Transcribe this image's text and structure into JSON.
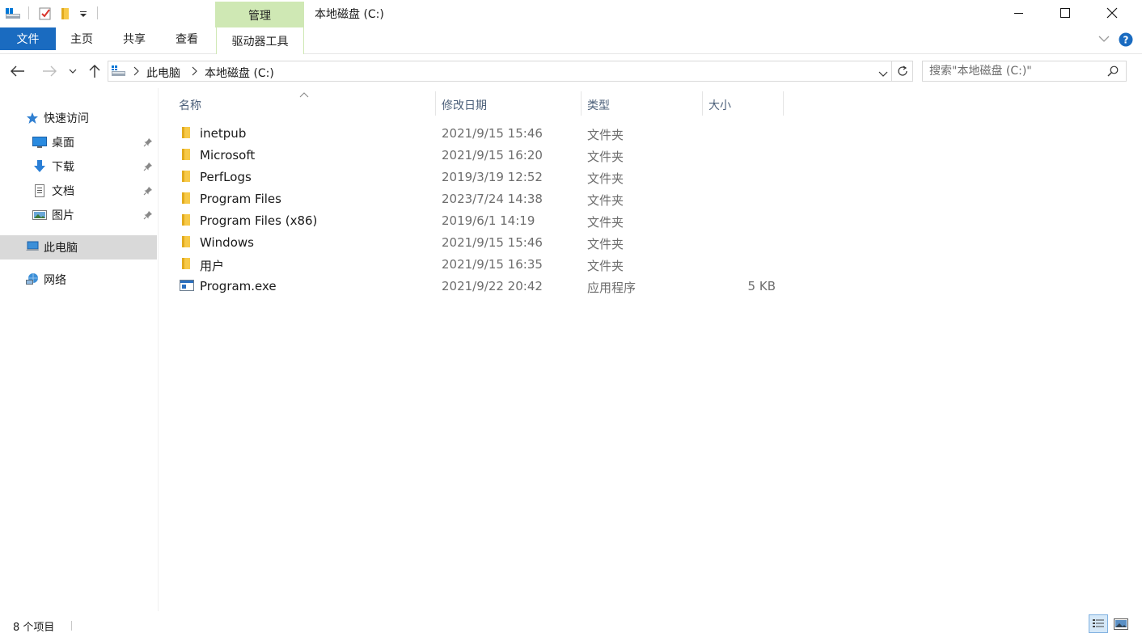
{
  "window": {
    "title": "本地磁盘 (C:)",
    "manage_tab": "管理"
  },
  "ribbon": {
    "tabs": [
      "文件",
      "主页",
      "共享",
      "查看",
      "驱动器工具"
    ]
  },
  "address": {
    "crumbs": [
      "此电脑",
      "本地磁盘 (C:)"
    ]
  },
  "search": {
    "placeholder": "搜索\"本地磁盘 (C:)\""
  },
  "sidebar": {
    "quick_access": "快速访问",
    "quick_items": [
      {
        "label": "桌面",
        "icon": "desktop-icon"
      },
      {
        "label": "下载",
        "icon": "download-icon"
      },
      {
        "label": "文档",
        "icon": "document-icon"
      },
      {
        "label": "图片",
        "icon": "picture-icon"
      }
    ],
    "this_pc": "此电脑",
    "network": "网络"
  },
  "columns": {
    "name": "名称",
    "date": "修改日期",
    "type": "类型",
    "size": "大小"
  },
  "files": [
    {
      "name": "inetpub",
      "date": "2021/9/15 15:46",
      "type": "文件夹",
      "size": "",
      "icon": "folder-icon"
    },
    {
      "name": "Microsoft",
      "date": "2021/9/15 16:20",
      "type": "文件夹",
      "size": "",
      "icon": "folder-icon"
    },
    {
      "name": "PerfLogs",
      "date": "2019/3/19 12:52",
      "type": "文件夹",
      "size": "",
      "icon": "folder-icon"
    },
    {
      "name": "Program Files",
      "date": "2023/7/24 14:38",
      "type": "文件夹",
      "size": "",
      "icon": "folder-icon"
    },
    {
      "name": "Program Files (x86)",
      "date": "2019/6/1 14:19",
      "type": "文件夹",
      "size": "",
      "icon": "folder-icon"
    },
    {
      "name": "Windows",
      "date": "2021/9/15 15:46",
      "type": "文件夹",
      "size": "",
      "icon": "folder-icon"
    },
    {
      "name": "用户",
      "date": "2021/9/15 16:35",
      "type": "文件夹",
      "size": "",
      "icon": "folder-icon"
    },
    {
      "name": "Program.exe",
      "date": "2021/9/22 20:42",
      "type": "应用程序",
      "size": "5 KB",
      "icon": "exe-icon"
    }
  ],
  "status": {
    "item_count": "8 个项目"
  },
  "colors": {
    "file_tab": "#1a6bc0",
    "manage_tab": "#cfe8b4",
    "folder": "#f7c948",
    "selected": "#d9d9d9"
  }
}
